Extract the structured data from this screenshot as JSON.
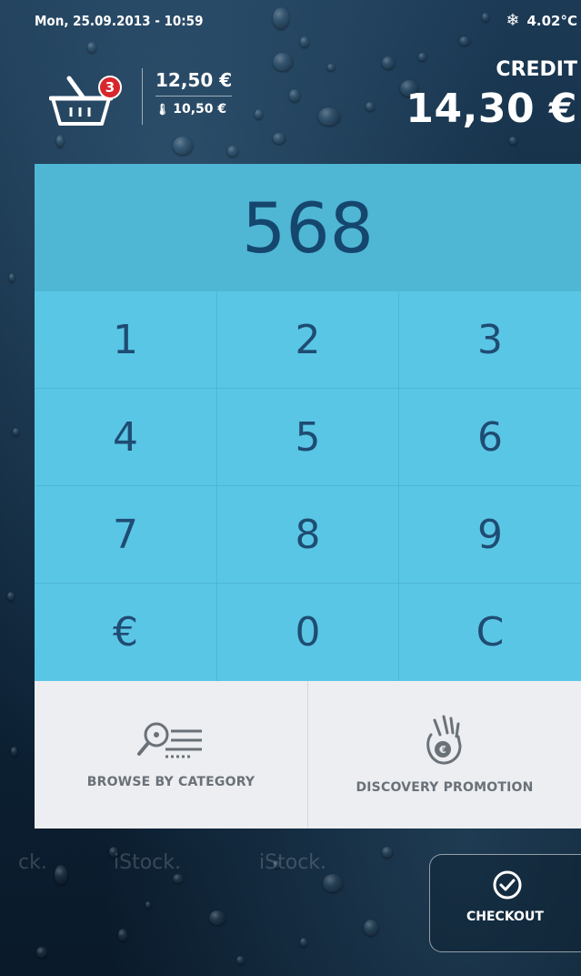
{
  "status_bar": {
    "datetime": "Mon, 25.09.2013 - 10:59",
    "temperature": "4.02°C",
    "temperature_icon": "snowflake-icon"
  },
  "cart": {
    "icon": "basket-icon",
    "item_count": "3",
    "total": "12,50 €",
    "chilled_total": "10,50 €",
    "chilled_icon": "thermometer-icon"
  },
  "credit": {
    "label": "CREDIT",
    "value": "14,30 €"
  },
  "keypad": {
    "display_value": "568",
    "keys": [
      "1",
      "2",
      "3",
      "4",
      "5",
      "6",
      "7",
      "8",
      "9",
      "€",
      "0",
      "C"
    ]
  },
  "actions": {
    "browse_label": "BROWSE BY CATEGORY",
    "browse_icon": "search-list-icon",
    "discovery_label": "DISCOVERY PROMOTION",
    "discovery_icon": "ok-hand-coin-icon"
  },
  "checkout": {
    "label": "CHECKOUT",
    "icon": "check-circle-icon"
  },
  "colors": {
    "display_bg": "#4fb6d4",
    "keys_bg": "#5ac6e6",
    "key_text": "#1f4c72",
    "actions_bg": "#eceef1",
    "badge": "#d7262c"
  }
}
